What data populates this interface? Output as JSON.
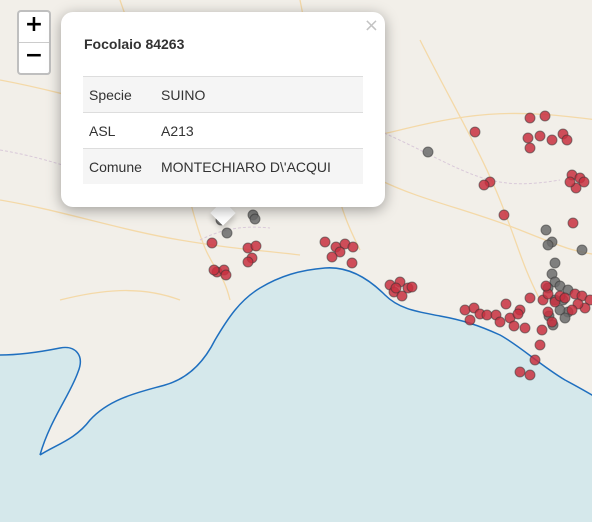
{
  "map": {
    "land_color": "#f2efe9",
    "sea_color": "#d5e8eb",
    "coast_color": "#1f6fbf",
    "marker_colors": {
      "case": "#c8303f",
      "other": "#6b6b6b"
    }
  },
  "zoom": {
    "in_label": "+",
    "out_label": "−"
  },
  "popup": {
    "close_label": "×",
    "title": "Focolaio 84263",
    "rows": [
      {
        "key": "Specie",
        "value": "SUINO"
      },
      {
        "key": "ASL",
        "value": "A213"
      },
      {
        "key": "Comune",
        "value": "MONTECHIARO D\\'ACQUI"
      }
    ]
  }
}
